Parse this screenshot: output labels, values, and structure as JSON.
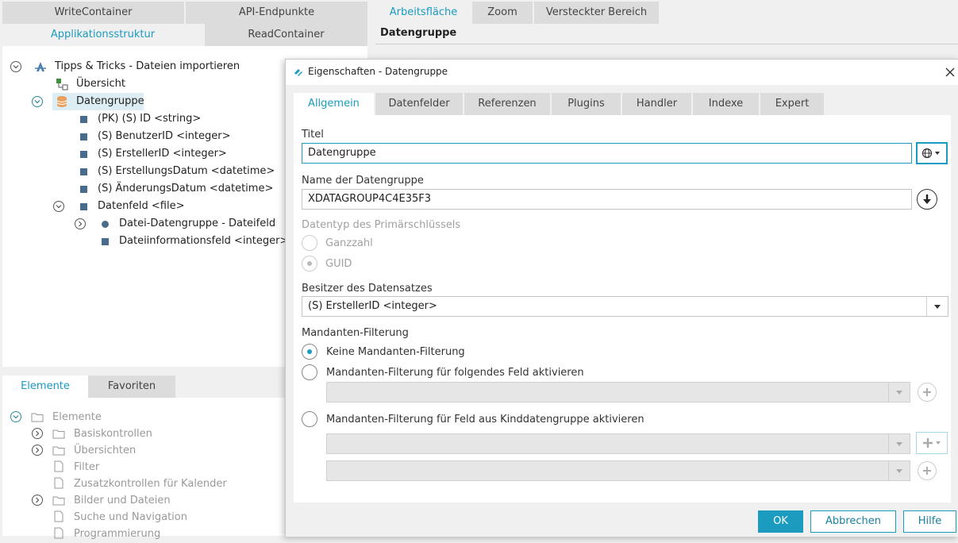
{
  "left_tabs": {
    "write_container": "WriteContainer",
    "api_endpoints": "API-Endpunkte",
    "app_structure": "Applikationsstruktur",
    "read_container": "ReadContainer"
  },
  "tree": {
    "root": "Tipps & Tricks - Dateien importieren",
    "overview": "Übersicht",
    "datagroup": "Datengruppe",
    "fields": [
      "(PK) (S) ID <string>",
      "(S) BenutzerID <integer>",
      "(S) ErstellerID <integer>",
      "(S) ErstellungsDatum <datetime>",
      "(S) ÄnderungsDatum <datetime>"
    ],
    "file_field": "Datenfeld <file>",
    "file_sub1": "Datei-Datengruppe - Dateifeld",
    "file_sub2": "Dateiinformationsfeld <integer>"
  },
  "elements_tabs": {
    "elements": "Elemente",
    "favorites": "Favoriten"
  },
  "elements_tree": {
    "root": "Elemente",
    "items": [
      "Basiskontrollen",
      "Übersichten",
      "Filter",
      "Zusatzkontrollen für Kalender",
      "Bilder und Dateien",
      "Suche und Navigation",
      "Programmierung"
    ]
  },
  "right_tabs": {
    "workspace": "Arbeitsfläche",
    "zoom": "Zoom",
    "hidden": "Versteckter Bereich"
  },
  "workspace_title": "Datengruppe",
  "dialog": {
    "title": "Eigenschaften - Datengruppe",
    "tabs": [
      "Allgemein",
      "Datenfelder",
      "Referenzen",
      "Plugins",
      "Handler",
      "Indexe",
      "Expert"
    ],
    "titel_label": "Titel",
    "titel_value": "Datengruppe",
    "name_label": "Name der Datengruppe",
    "name_value": "XDATAGROUP4C4E35F3",
    "pk_type_label": "Datentyp des Primärschlüssels",
    "pk_integer": "Ganzzahl",
    "pk_guid": "GUID",
    "owner_label": "Besitzer des Datensatzes",
    "owner_value": "(S) ErstellerID <integer>",
    "tenant_label": "Mandanten-Filterung",
    "tenant_none": "Keine Mandanten-Filterung",
    "tenant_field": "Mandanten-Filterung für folgendes Feld aktivieren",
    "tenant_child": "Mandanten-Filterung für Feld aus Kinddatengruppe aktivieren",
    "ok": "OK",
    "cancel": "Abbrechen",
    "help": "Hilfe"
  },
  "colors": {
    "accent": "#1a9bbf",
    "node_square": "#4a6c8c"
  }
}
